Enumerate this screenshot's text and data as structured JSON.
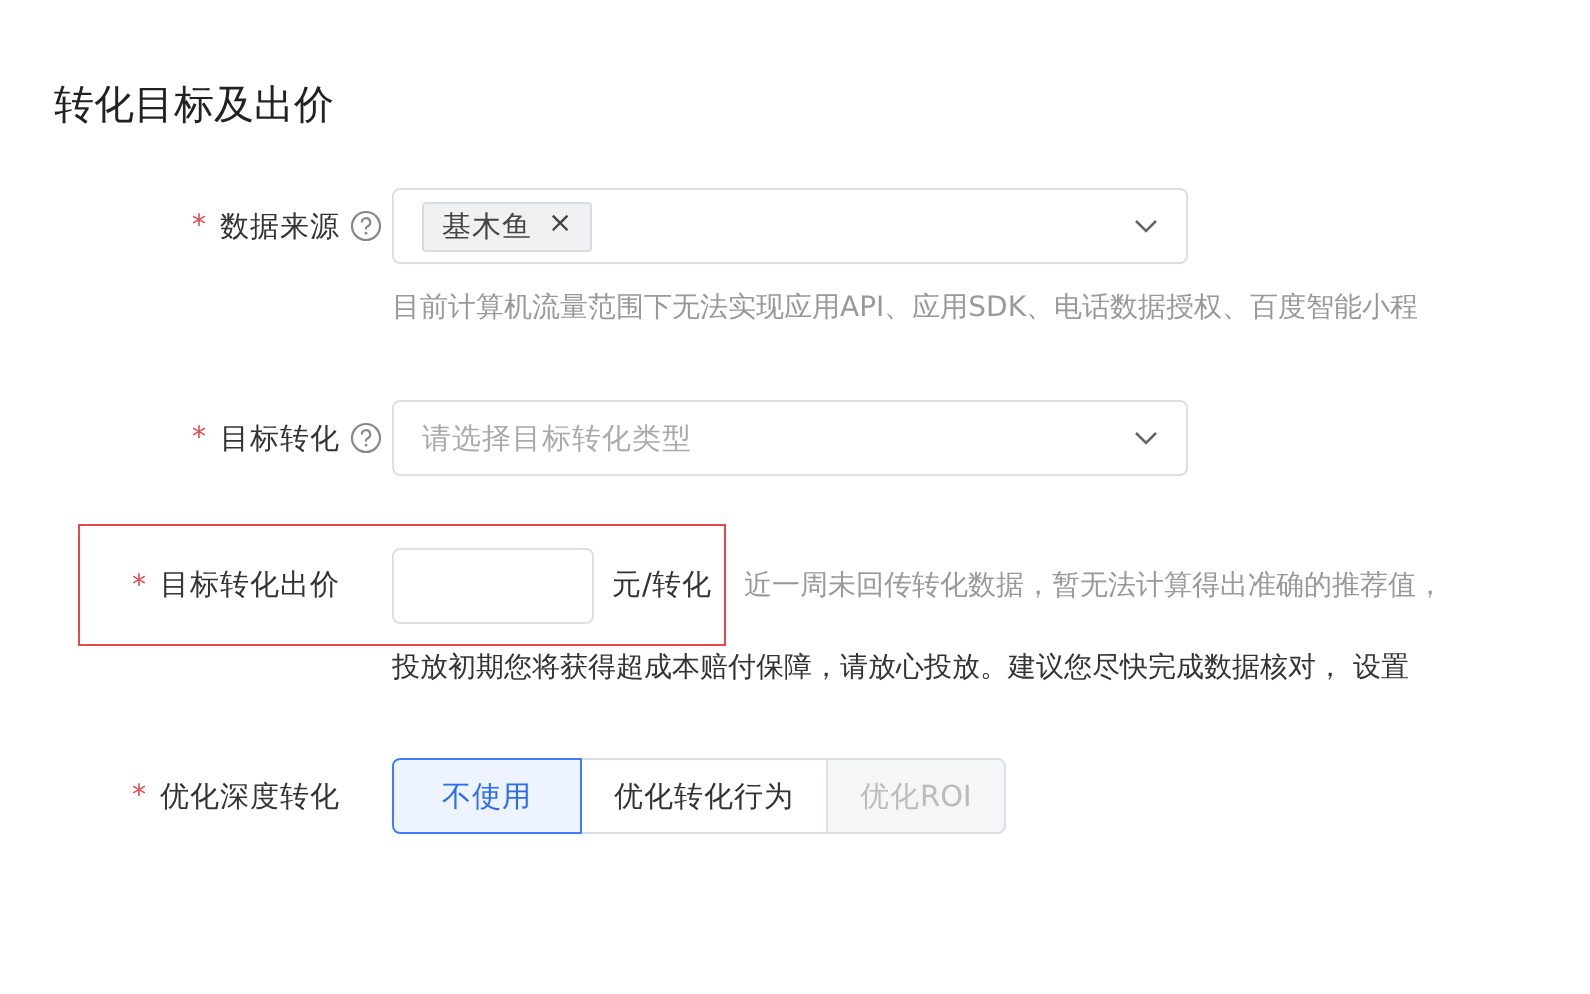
{
  "title": "转化目标及出价",
  "fields": [
    {
      "kind": "select",
      "label": "数据来源",
      "required": "*",
      "help": true,
      "tags": [
        {
          "text": "基木鱼",
          "close": "×"
        }
      ],
      "hint": "目前计算机流量范围下无法实现应用API、应用SDK、电话数据授权、百度智能小程"
    },
    {
      "kind": "select",
      "label": "目标转化",
      "required": "*",
      "help": true,
      "placeholder": "请选择目标转化类型"
    },
    {
      "kind": "input",
      "label": "目标转化出价",
      "required": "*",
      "highlighted": true,
      "unit": "元/转化",
      "note": "近一周未回传转化数据，暂无法计算得出准确的推荐值，",
      "hint": "投放初期您将获得超成本赔付保障，请放心投放。建议您尽快完成数据核对， 设置"
    },
    {
      "kind": "segmented",
      "label": "优化深度转化",
      "required": "*",
      "options": [
        {
          "label": "不使用",
          "selected": true,
          "disabled": false
        },
        {
          "label": "优化转化行为",
          "selected": false,
          "disabled": false
        },
        {
          "label": "优化ROI",
          "selected": false,
          "disabled": true
        }
      ]
    }
  ]
}
